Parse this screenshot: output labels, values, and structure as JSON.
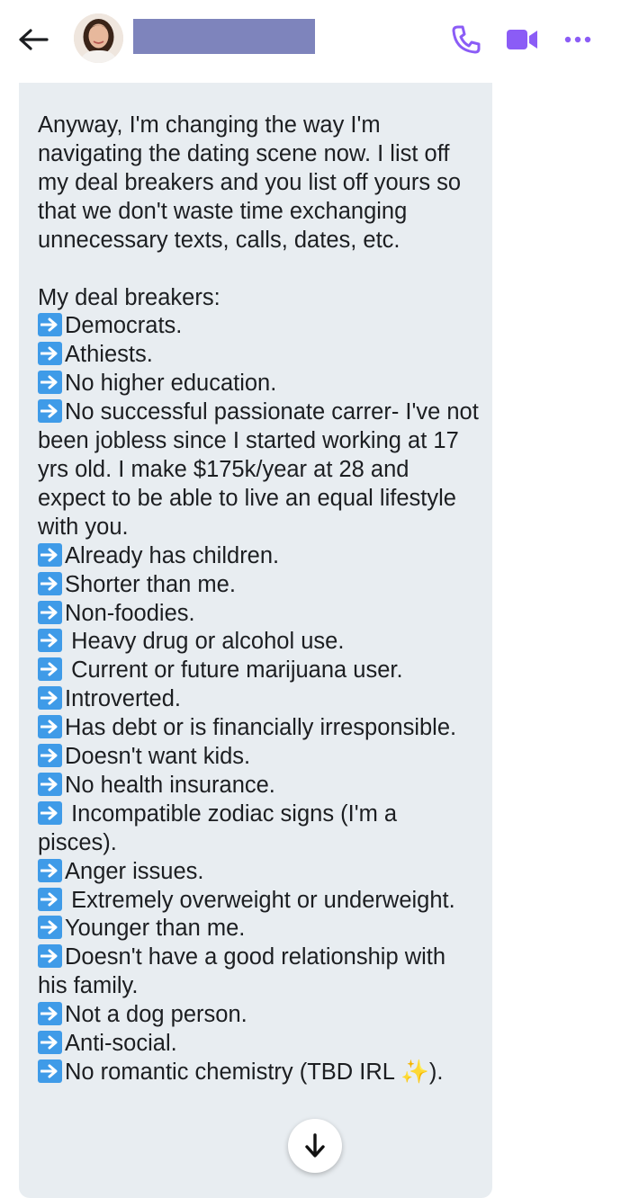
{
  "header": {
    "back_icon": "arrow-left-icon",
    "avatar": "contact-photo",
    "contact_name_redacted": true,
    "call_icon": "phone-icon",
    "video_icon": "video-camera-icon",
    "more_icon": "more-dots-icon",
    "accent_color": "#8b5cf6"
  },
  "message": {
    "intro": "Anyway, I'm changing the way I'm navigating the dating scene now. I list off my deal breakers and you list off yours so that we don't waste time exchanging unnecessary texts, calls, dates, etc.",
    "list_heading": "My deal breakers:",
    "bullet_icon": "right-arrow-emoji",
    "items": [
      "Democrats.",
      "Athiests.",
      "No higher education.",
      "No successful passionate carrer- I've not been jobless since I started working at 17 yrs old. I make $175k/year at 28 and expect to be able to live an equal lifestyle with you.",
      "Already has children.",
      "Shorter than me.",
      "Non-foodies.",
      " Heavy drug or alcohol use.",
      " Current or future marijuana user.",
      "Introverted.",
      "Has debt or is financially irresponsible.",
      "Doesn't want kids.",
      "No health insurance.",
      " Incompatible zodiac signs (I'm a pisces).",
      "Anger issues.",
      " Extremely overweight or underweight.",
      "Younger than me.",
      "Doesn't have a good relationship with his family.",
      "Not a dog person.",
      "Anti-social."
    ],
    "last_item_text": "No romantic chemistry (TBD IRL ",
    "last_item_emoji": "✨",
    "last_item_end": ")."
  },
  "scroll_down_icon": "arrow-down-icon"
}
